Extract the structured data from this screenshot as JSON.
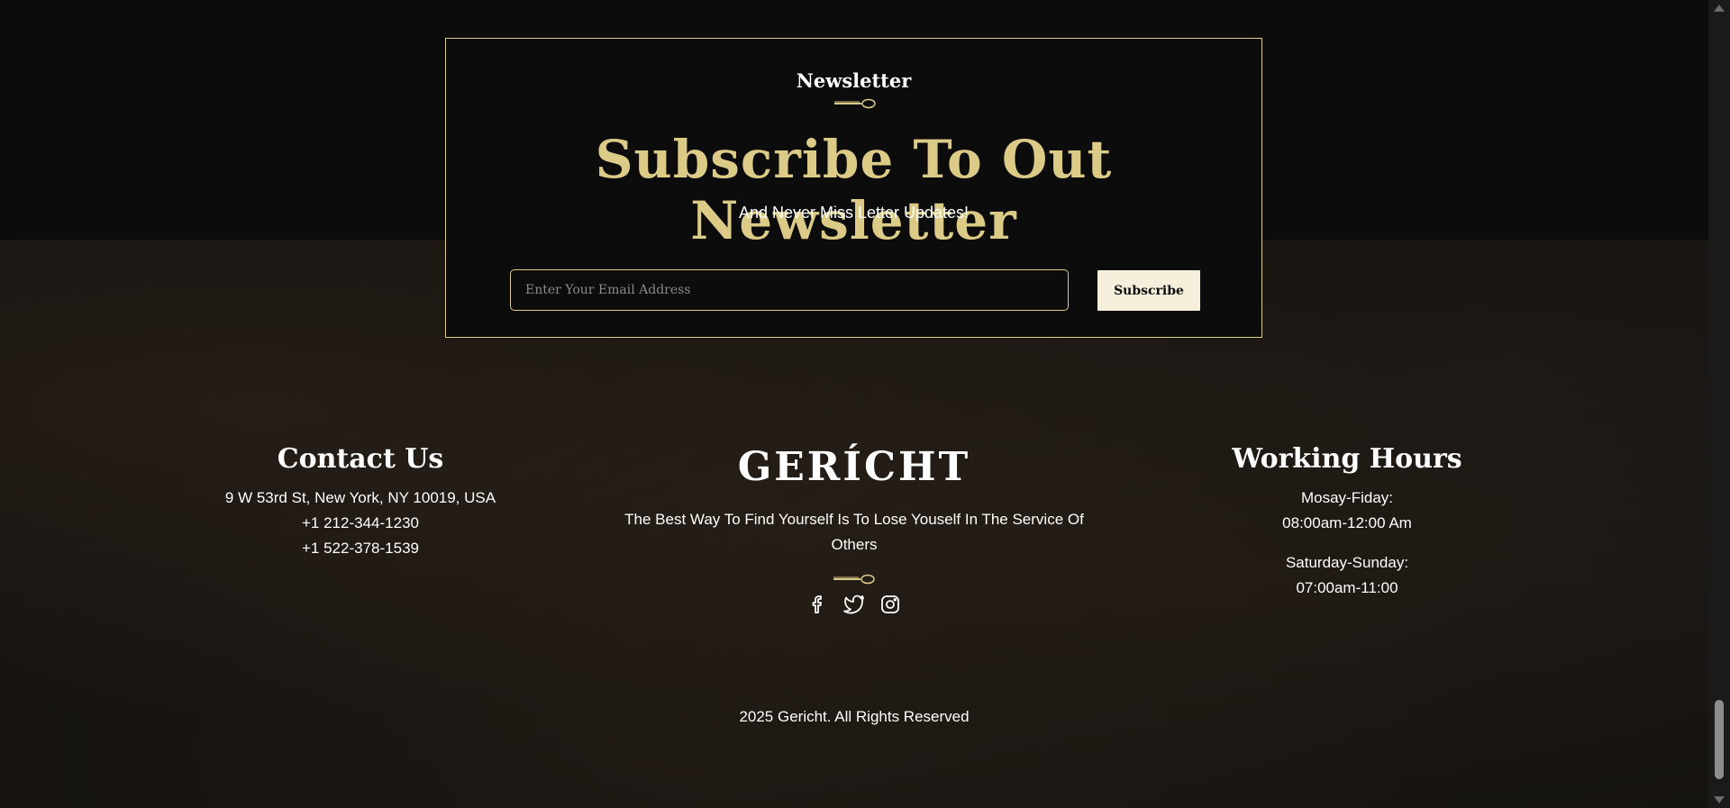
{
  "newsletter": {
    "subtitle": "Newsletter",
    "title": "Subscribe To Out Newsletter",
    "description": "And Never Miss Letter Updates!",
    "email_placeholder": "Enter Your Email Address",
    "email_value": "",
    "subscribe_label": "Subscribe"
  },
  "contact": {
    "title": "Contact Us",
    "address": "9 W 53rd St, New York, NY 10019, USA",
    "phone1": "+1 212-344-1230",
    "phone2": "+1 522-378-1539"
  },
  "brand": {
    "logo": "GERÍCHT",
    "tagline": "The Best Way To Find Yourself Is To Lose Youself In The Service Of Others",
    "socials": [
      "facebook-icon",
      "twitter-icon",
      "instagram-icon"
    ]
  },
  "hours": {
    "title": "Working Hours",
    "weekday_label": "Mosay-Fiday:",
    "weekday_time": "08:00am-12:00 Am",
    "weekend_label": "Saturday-Sunday:",
    "weekend_time": "07:00am-11:00"
  },
  "copyright": "2025 Gericht. All Rights Reserved",
  "colors": {
    "accent": "#dcca87",
    "background": "#0c0c0c",
    "button_bg": "#f5efdb",
    "text": "#ffffff"
  }
}
